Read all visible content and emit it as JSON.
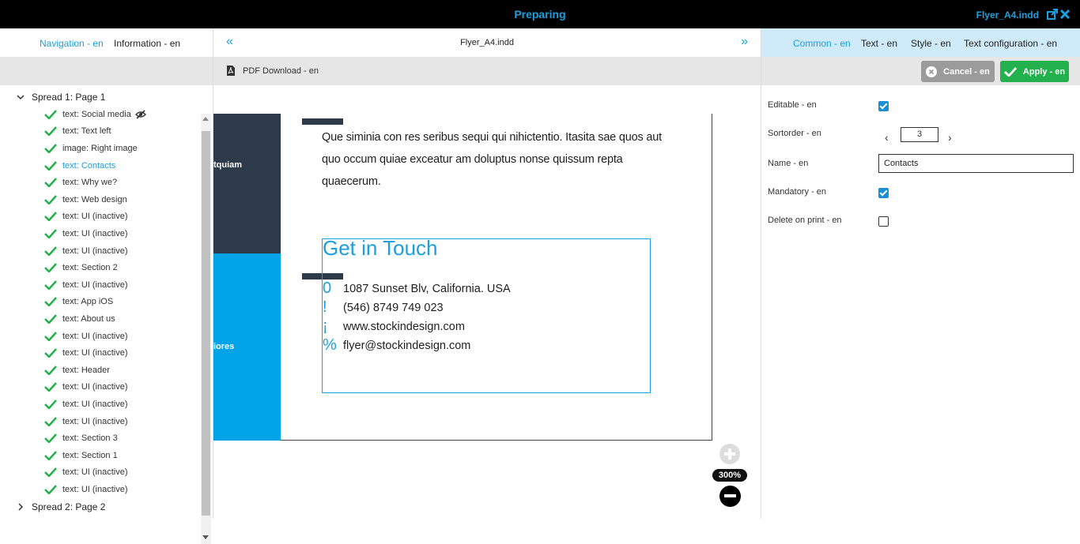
{
  "topbar": {
    "title": "Preparing",
    "filename": "Flyer_A4.indd"
  },
  "left": {
    "tabs": [
      "Navigation - en",
      "Information - en"
    ],
    "spreads": [
      {
        "label": "Spread 1: Page 1",
        "items": [
          {
            "label": "text: Social media"
          },
          {
            "label": "text: Text left"
          },
          {
            "label": "image: Right image"
          },
          {
            "label": "text: Contacts"
          },
          {
            "label": "text: Why we?"
          },
          {
            "label": "text: Web design"
          },
          {
            "label": "text: UI (inactive)"
          },
          {
            "label": "text: UI (inactive)"
          },
          {
            "label": "text: UI (inactive)"
          },
          {
            "label": "text: Section 2"
          },
          {
            "label": "text: UI (inactive)"
          },
          {
            "label": "text: App iOS"
          },
          {
            "label": "text: About us"
          },
          {
            "label": "text: UI (inactive)"
          },
          {
            "label": "text: UI (inactive)"
          },
          {
            "label": "text: Header"
          },
          {
            "label": "text: UI (inactive)"
          },
          {
            "label": "text: UI (inactive)"
          },
          {
            "label": "text: UI (inactive)"
          },
          {
            "label": "text: Section 3"
          },
          {
            "label": "text: Section 1"
          },
          {
            "label": "text: UI (inactive)"
          },
          {
            "label": "text: UI (inactive)"
          }
        ]
      },
      {
        "label": "Spread 2: Page 2"
      }
    ]
  },
  "center": {
    "filename": "Flyer_A4.indd",
    "pdf_download": "PDF Download - en",
    "zoom": "300%",
    "doc": {
      "dark_strip_text": "tquiam",
      "blue_strip_text": "iores",
      "paragraph": "Que siminia con res seribus sequi qui nihictentio. Itasita sae quos aut quo occum quiae exceatur am doluptus nonse quis­sum repta quaecerum.",
      "contact_heading": "Get in Touch",
      "contact_glyphs": [
        "0",
        "!",
        "¡",
        "%"
      ],
      "contact_lines": [
        "1087 Sunset Blv, California. USA",
        "(546) 8749 749 023",
        "www.stockindesign.com",
        "flyer@stockindesign.com"
      ]
    }
  },
  "right": {
    "tabs": [
      "Common - en",
      "Text - en",
      "Style - en",
      "Text configuration - en"
    ],
    "cancel": "Cancel - en",
    "apply": "Apply - en",
    "form": {
      "editable_label": "Editable - en",
      "editable": true,
      "sortorder_label": "Sortorder - en",
      "sortorder": "3",
      "name_label": "Name - en",
      "name": "Contacts",
      "mandatory_label": "Mandatory - en",
      "mandatory": true,
      "delete_label": "Delete on print - en",
      "delete_on_print": false
    }
  },
  "colors": {
    "accent": "#1aa0de",
    "apply_green": "#23b14d",
    "cancel_grey": "#9b9b9b",
    "doc_dark": "#2d3a4a",
    "doc_blue": "#00a3e8"
  }
}
